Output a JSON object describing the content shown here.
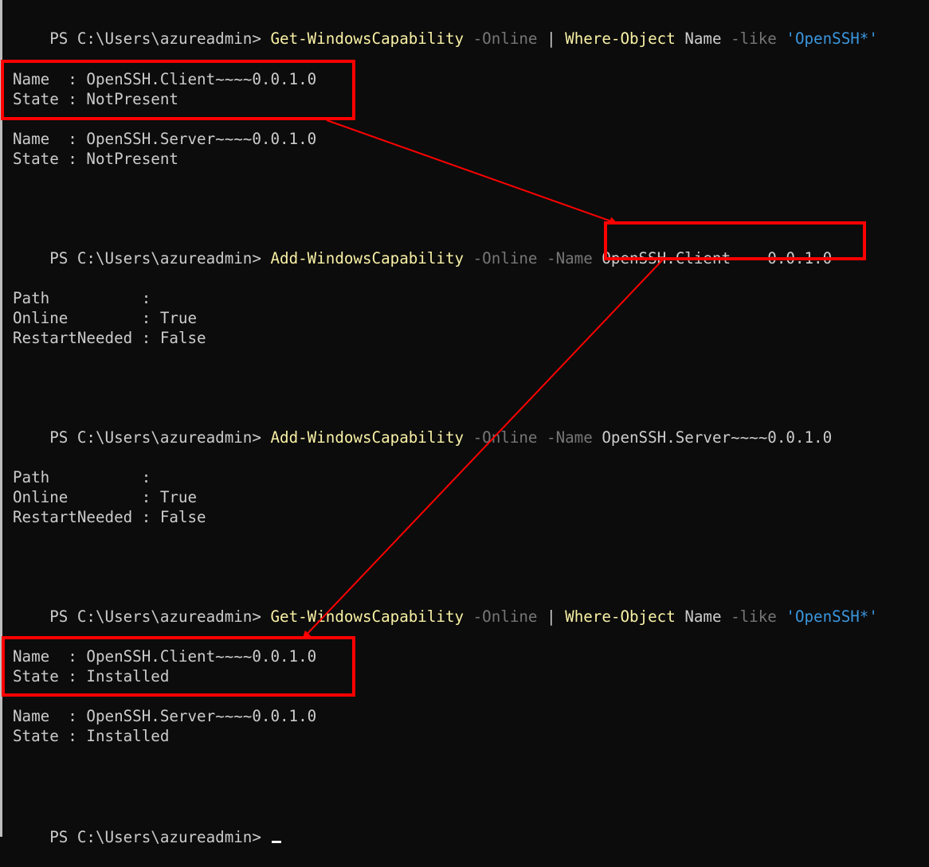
{
  "prompt": "PS C:\\Users\\azureadmin> ",
  "colors": {
    "background": "#0c0c0c",
    "text": "#cccccc",
    "command": "#f9f1a5",
    "parameter": "#767676",
    "string": "#3a96dd",
    "highlight": "#ff0000"
  },
  "block1": {
    "cmd1": "Get-WindowsCapability",
    "param1": " -Online ",
    "pipe": "| ",
    "cmd2": "Where-Object",
    "arg": " Name ",
    "param2": "-like ",
    "str": "'OpenSSH*'"
  },
  "result1": {
    "client_name": "Name  : OpenSSH.Client~~~~0.0.1.0",
    "client_state": "State : NotPresent",
    "server_name": "Name  : OpenSSH.Server~~~~0.0.1.0",
    "server_state": "State : NotPresent"
  },
  "block2": {
    "cmd": "Add-WindowsCapability",
    "params": " -Online -Name ",
    "arg": "OpenSSH.Client~~~~0.0.1.0"
  },
  "result2": {
    "path": "Path          :",
    "online": "Online        : True",
    "restart": "RestartNeeded : False"
  },
  "block3": {
    "cmd": "Add-WindowsCapability",
    "params": " -Online -Name ",
    "arg": "OpenSSH.Server~~~~0.0.1.0"
  },
  "result3": {
    "path": "Path          :",
    "online": "Online        : True",
    "restart": "RestartNeeded : False"
  },
  "block4": {
    "cmd1": "Get-WindowsCapability",
    "param1": " -Online ",
    "pipe": "| ",
    "cmd2": "Where-Object",
    "arg": " Name ",
    "param2": "-like ",
    "str": "'OpenSSH*'"
  },
  "result4": {
    "client_name": "Name  : OpenSSH.Client~~~~0.0.1.0",
    "client_state": "State : Installed",
    "server_name": "Name  : OpenSSH.Server~~~~0.0.1.0",
    "server_state": "State : Installed"
  }
}
